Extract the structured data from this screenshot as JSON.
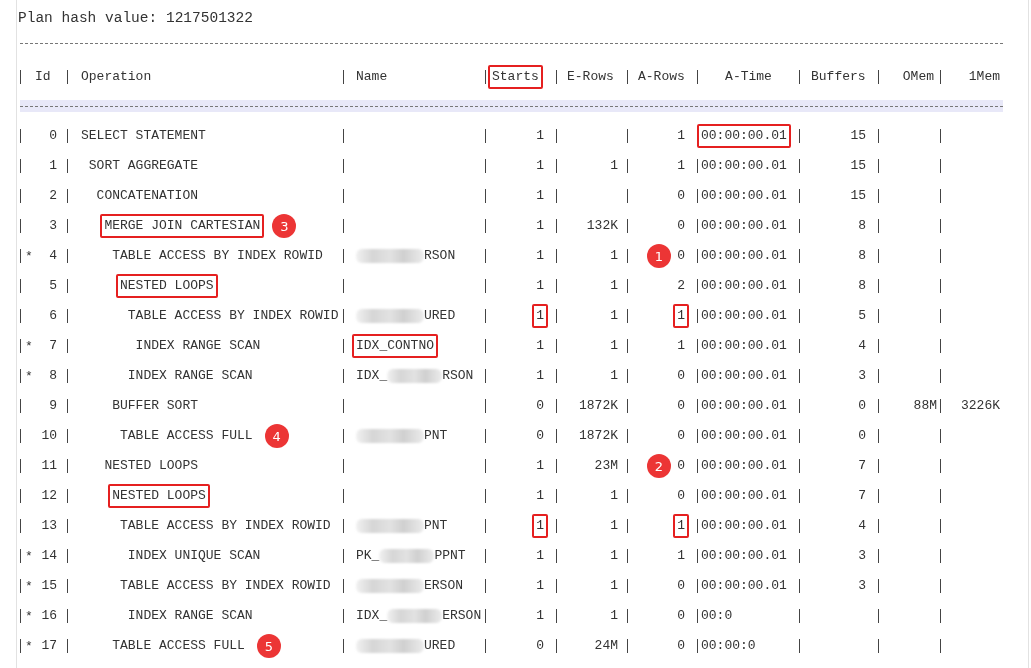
{
  "title": "Plan hash value: 1217501322",
  "columns": [
    {
      "label": "Id",
      "highlighted": false
    },
    {
      "label": "Operation",
      "highlighted": false
    },
    {
      "label": "Name",
      "highlighted": false
    },
    {
      "label": "Starts",
      "highlighted": true
    },
    {
      "label": "E-Rows",
      "highlighted": false
    },
    {
      "label": "A-Rows",
      "highlighted": false
    },
    {
      "label": "A-Time",
      "highlighted": false
    },
    {
      "label": "Buffers",
      "highlighted": false
    },
    {
      "label": "OMem",
      "highlighted": false
    },
    {
      "label": "1Mem",
      "highlighted": false
    }
  ],
  "rows": [
    {
      "id": "0",
      "operation": {
        "text": "SELECT STATEMENT",
        "highlighted": false
      },
      "starts": {
        "text": "1",
        "highlighted": false
      },
      "a_rows": {
        "text": "1",
        "highlighted": false
      },
      "a_time": {
        "text": "00:00:00.01",
        "highlighted": true
      },
      "buffers": {
        "text": "15",
        "highlighted": false
      },
      "children": [
        {
          "id": "1",
          "operation": {
            "text": "SORT AGGREGATE",
            "highlighted": false
          },
          "starts": {
            "text": "1",
            "highlighted": false
          },
          "e_rows": {
            "text": "1",
            "highlighted": false
          },
          "a_rows": {
            "text": "1",
            "highlighted": false
          },
          "a_time": {
            "text": "00:00:00.01",
            "highlighted": false
          },
          "buffers": {
            "text": "15",
            "highlighted": false
          },
          "children": [
            {
              "id": "2",
              "operation": {
                "text": "CONCATENATION",
                "highlighted": false
              },
              "starts": {
                "text": "1",
                "highlighted": false
              },
              "a_rows": {
                "text": "0",
                "highlighted": false
              },
              "a_time": {
                "text": "00:00:00.01",
                "highlighted": false
              },
              "buffers": {
                "text": "15",
                "highlighted": false
              },
              "children": [
                {
                  "id": "3",
                  "operation": {
                    "text": "MERGE JOIN CARTESIAN",
                    "highlighted": true
                  },
                  "badge": {
                    "label": "3",
                    "kind": "operation"
                  },
                  "starts": {
                    "text": "1",
                    "highlighted": false
                  },
                  "e_rows": {
                    "text": "132K",
                    "highlighted": false
                  },
                  "a_rows": {
                    "text": "0",
                    "highlighted": false
                  },
                  "a_time": {
                    "text": "00:00:00.01",
                    "highlighted": false
                  },
                  "buffers": {
                    "text": "8",
                    "highlighted": false
                  },
                  "children": [
                    {
                      "id": "4",
                      "marker": "*",
                      "operation": {
                        "text": "TABLE ACCESS BY INDEX ROWID",
                        "highlighted": false
                      },
                      "name": {
                        "suffix": "RSON",
                        "redacted": true,
                        "highlighted": false
                      },
                      "badge": {
                        "label": "1",
                        "kind": "a-rows"
                      },
                      "starts": {
                        "text": "1",
                        "highlighted": false
                      },
                      "e_rows": {
                        "text": "1",
                        "highlighted": false
                      },
                      "a_rows": {
                        "text": "0",
                        "highlighted": false
                      },
                      "a_time": {
                        "text": "00:00:00.01",
                        "highlighted": false
                      },
                      "buffers": {
                        "text": "8",
                        "highlighted": false
                      },
                      "children": [
                        {
                          "id": "5",
                          "operation": {
                            "text": "NESTED LOOPS",
                            "highlighted": true
                          },
                          "starts": {
                            "text": "1",
                            "highlighted": false
                          },
                          "e_rows": {
                            "text": "1",
                            "highlighted": false
                          },
                          "a_rows": {
                            "text": "2",
                            "highlighted": false
                          },
                          "a_time": {
                            "text": "00:00:00.01",
                            "highlighted": false
                          },
                          "buffers": {
                            "text": "8",
                            "highlighted": false
                          },
                          "children": [
                            {
                              "id": "6",
                              "operation": {
                                "text": "TABLE ACCESS BY INDEX ROWID",
                                "highlighted": false
                              },
                              "name": {
                                "suffix": "URED",
                                "redacted": true,
                                "highlighted": false
                              },
                              "starts": {
                                "text": "1",
                                "highlighted": true
                              },
                              "e_rows": {
                                "text": "1",
                                "highlighted": false
                              },
                              "a_rows": {
                                "text": "1",
                                "highlighted": true
                              },
                              "a_time": {
                                "text": "00:00:00.01",
                                "highlighted": false
                              },
                              "buffers": {
                                "text": "5",
                                "highlighted": false
                              },
                              "children": [
                                {
                                  "id": "7",
                                  "marker": "*",
                                  "operation": {
                                    "text": "INDEX RANGE SCAN",
                                    "highlighted": false
                                  },
                                  "name": {
                                    "prefix": "IDX_CONTNO",
                                    "redacted": false,
                                    "highlighted": true
                                  },
                                  "starts": {
                                    "text": "1",
                                    "highlighted": false
                                  },
                                  "e_rows": {
                                    "text": "1",
                                    "highlighted": false
                                  },
                                  "a_rows": {
                                    "text": "1",
                                    "highlighted": false
                                  },
                                  "a_time": {
                                    "text": "00:00:00.01",
                                    "highlighted": false
                                  },
                                  "buffers": {
                                    "text": "4",
                                    "highlighted": false
                                  }
                                }
                              ]
                            },
                            {
                              "id": "8",
                              "marker": "*",
                              "operation": {
                                "text": "INDEX RANGE SCAN",
                                "highlighted": false
                              },
                              "name": {
                                "prefix": "IDX_",
                                "suffix": "RSON",
                                "redacted": true,
                                "highlighted": false
                              },
                              "starts": {
                                "text": "1",
                                "highlighted": false
                              },
                              "e_rows": {
                                "text": "1",
                                "highlighted": false
                              },
                              "a_rows": {
                                "text": "0",
                                "highlighted": false
                              },
                              "a_time": {
                                "text": "00:00:00.01",
                                "highlighted": false
                              },
                              "buffers": {
                                "text": "3",
                                "highlighted": false
                              }
                            }
                          ]
                        }
                      ]
                    },
                    {
                      "id": "9",
                      "operation": {
                        "text": "BUFFER SORT",
                        "highlighted": false
                      },
                      "starts": {
                        "text": "0",
                        "highlighted": false
                      },
                      "e_rows": {
                        "text": "1872K",
                        "highlighted": false
                      },
                      "a_rows": {
                        "text": "0",
                        "highlighted": false
                      },
                      "a_time": {
                        "text": "00:00:00.01",
                        "highlighted": false
                      },
                      "buffers": {
                        "text": "0",
                        "highlighted": false
                      },
                      "omem": {
                        "text": "88M",
                        "highlighted": false
                      },
                      "mem1": {
                        "text": "3226K",
                        "highlighted": false
                      },
                      "children": [
                        {
                          "id": "10",
                          "operation": {
                            "text": "TABLE ACCESS FULL",
                            "highlighted": false
                          },
                          "name": {
                            "suffix": "PNT",
                            "redacted": true,
                            "highlighted": false
                          },
                          "badge": {
                            "label": "4",
                            "kind": "operation"
                          },
                          "starts": {
                            "text": "0",
                            "highlighted": false
                          },
                          "e_rows": {
                            "text": "1872K",
                            "highlighted": false
                          },
                          "a_rows": {
                            "text": "0",
                            "highlighted": false
                          },
                          "a_time": {
                            "text": "00:00:00.01",
                            "highlighted": false
                          },
                          "buffers": {
                            "text": "0",
                            "highlighted": false
                          }
                        }
                      ]
                    }
                  ]
                },
                {
                  "id": "11",
                  "operation": {
                    "text": "NESTED LOOPS",
                    "highlighted": false
                  },
                  "badge": {
                    "label": "2",
                    "kind": "a-rows"
                  },
                  "starts": {
                    "text": "1",
                    "highlighted": false
                  },
                  "e_rows": {
                    "text": "23M",
                    "highlighted": false
                  },
                  "a_rows": {
                    "text": "0",
                    "highlighted": false
                  },
                  "a_time": {
                    "text": "00:00:00.01",
                    "highlighted": false
                  },
                  "buffers": {
                    "text": "7",
                    "highlighted": false
                  },
                  "children": [
                    {
                      "id": "12",
                      "operation": {
                        "text": "NESTED LOOPS",
                        "highlighted": true
                      },
                      "starts": {
                        "text": "1",
                        "highlighted": false
                      },
                      "e_rows": {
                        "text": "1",
                        "highlighted": false
                      },
                      "a_rows": {
                        "text": "0",
                        "highlighted": false
                      },
                      "a_time": {
                        "text": "00:00:00.01",
                        "highlighted": false
                      },
                      "buffers": {
                        "text": "7",
                        "highlighted": false
                      },
                      "children": [
                        {
                          "id": "13",
                          "operation": {
                            "text": "TABLE ACCESS BY INDEX ROWID",
                            "highlighted": false
                          },
                          "name": {
                            "suffix": "PNT",
                            "redacted": true,
                            "highlighted": false
                          },
                          "starts": {
                            "text": "1",
                            "highlighted": true
                          },
                          "e_rows": {
                            "text": "1",
                            "highlighted": false
                          },
                          "a_rows": {
                            "text": "1",
                            "highlighted": true
                          },
                          "a_time": {
                            "text": "00:00:00.01",
                            "highlighted": false
                          },
                          "buffers": {
                            "text": "4",
                            "highlighted": false
                          },
                          "children": [
                            {
                              "id": "14",
                              "marker": "*",
                              "operation": {
                                "text": "INDEX UNIQUE SCAN",
                                "highlighted": false
                              },
                              "name": {
                                "prefix": "PK_",
                                "suffix": "PPNT",
                                "redacted": true,
                                "highlighted": false
                              },
                              "starts": {
                                "text": "1",
                                "highlighted": false
                              },
                              "e_rows": {
                                "text": "1",
                                "highlighted": false
                              },
                              "a_rows": {
                                "text": "1",
                                "highlighted": false
                              },
                              "a_time": {
                                "text": "00:00:00.01",
                                "highlighted": false
                              },
                              "buffers": {
                                "text": "3",
                                "highlighted": false
                              }
                            }
                          ]
                        },
                        {
                          "id": "15",
                          "marker": "*",
                          "operation": {
                            "text": "TABLE ACCESS BY INDEX ROWID",
                            "highlighted": false
                          },
                          "name": {
                            "suffix": "ERSON",
                            "redacted": true,
                            "highlighted": false
                          },
                          "starts": {
                            "text": "1",
                            "highlighted": false
                          },
                          "e_rows": {
                            "text": "1",
                            "highlighted": false
                          },
                          "a_rows": {
                            "text": "0",
                            "highlighted": false
                          },
                          "a_time": {
                            "text": "00:00:00.01",
                            "highlighted": false
                          },
                          "buffers": {
                            "text": "3",
                            "highlighted": false
                          },
                          "children": [
                            {
                              "id": "16",
                              "marker": "*",
                              "operation": {
                                "text": "INDEX RANGE SCAN",
                                "highlighted": false
                              },
                              "name": {
                                "prefix": "IDX_",
                                "suffix": "ERSON",
                                "redacted": true,
                                "highlighted": false
                              },
                              "starts": {
                                "text": "1",
                                "highlighted": false
                              },
                              "e_rows": {
                                "text": "1",
                                "highlighted": false
                              },
                              "a_rows": {
                                "text": "0",
                                "highlighted": false
                              },
                              "a_time": {
                                "text": "00:0",
                                "highlighted": false
                              }
                            }
                          ]
                        }
                      ]
                    },
                    {
                      "id": "17",
                      "marker": "*",
                      "operation": {
                        "text": "TABLE ACCESS FULL",
                        "highlighted": false
                      },
                      "name": {
                        "suffix": "URED",
                        "redacted": true,
                        "highlighted": false
                      },
                      "badge": {
                        "label": "5",
                        "kind": "operation"
                      },
                      "starts": {
                        "text": "0",
                        "highlighted": false
                      },
                      "e_rows": {
                        "text": "24M",
                        "highlighted": false
                      },
                      "a_rows": {
                        "text": "0",
                        "highlighted": false
                      },
                      "a_time": {
                        "text": "00:00:0",
                        "highlighted": false
                      }
                    }
                  ]
                }
              ]
            }
          ]
        }
      ]
    }
  ]
}
